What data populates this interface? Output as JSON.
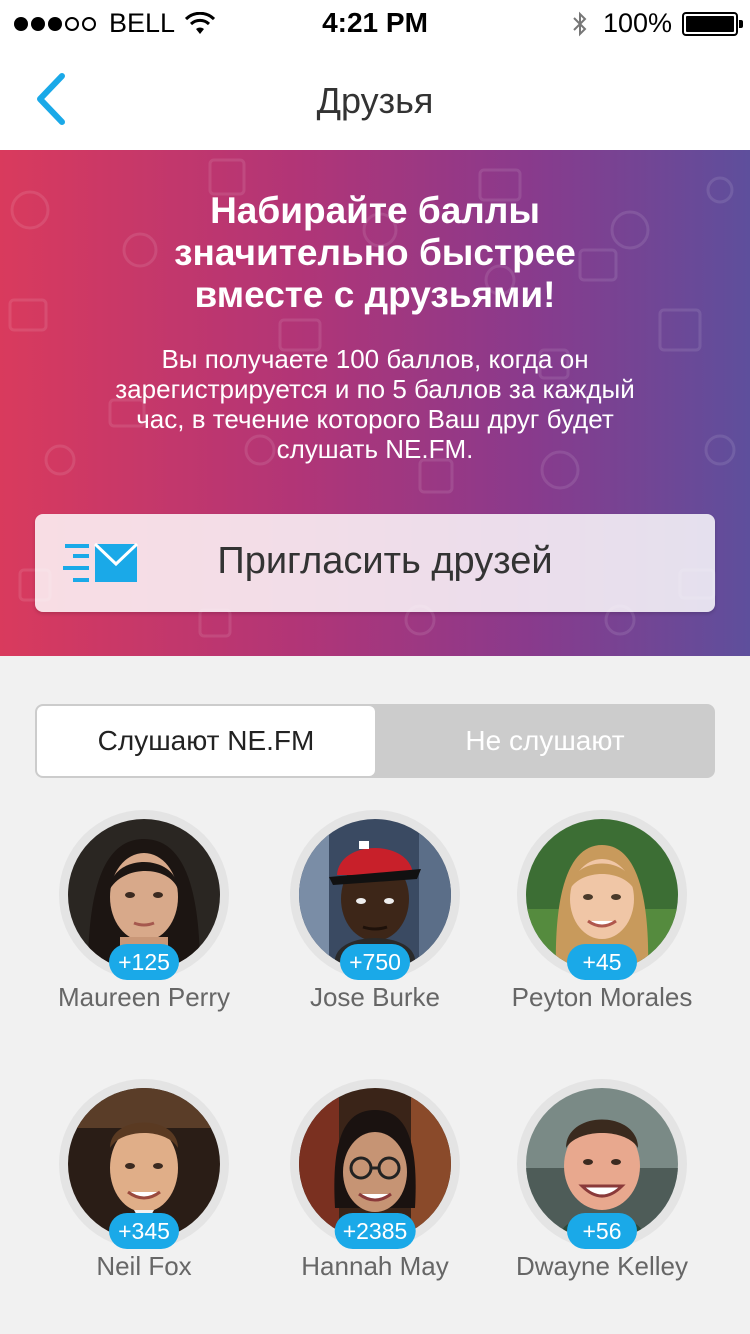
{
  "status_bar": {
    "carrier": "BELL",
    "time": "4:21 PM",
    "battery": "100%",
    "signal_bars_filled": 3,
    "signal_bars_total": 5
  },
  "nav": {
    "title": "Друзья"
  },
  "hero": {
    "title_lines": [
      "Набирайте баллы",
      "значительно быстрее",
      "вместе с друзьями!"
    ],
    "description_lines": [
      "Вы получаете 100 баллов, когда он",
      "зарегистрируется и по 5 баллов за каждый",
      "час, в течение которого Ваш друг будет",
      "слушать NE.FM."
    ],
    "invite_label": "Пригласить друзей"
  },
  "tabs": {
    "active": "Слушают NE.FM",
    "inactive": "Не слушают"
  },
  "colors": {
    "accent": "#1aa9e8",
    "gradient_start": "#d93a5d",
    "gradient_end": "#5e4f9c"
  },
  "friends": [
    {
      "name": "Maureen Perry",
      "score": "+125"
    },
    {
      "name": "Jose Burke",
      "score": "+750"
    },
    {
      "name": "Peyton Morales",
      "score": "+45"
    },
    {
      "name": "Neil Fox",
      "score": "+345"
    },
    {
      "name": "Hannah May",
      "score": "+2385"
    },
    {
      "name": "Dwayne Kelley",
      "score": "+56"
    }
  ]
}
